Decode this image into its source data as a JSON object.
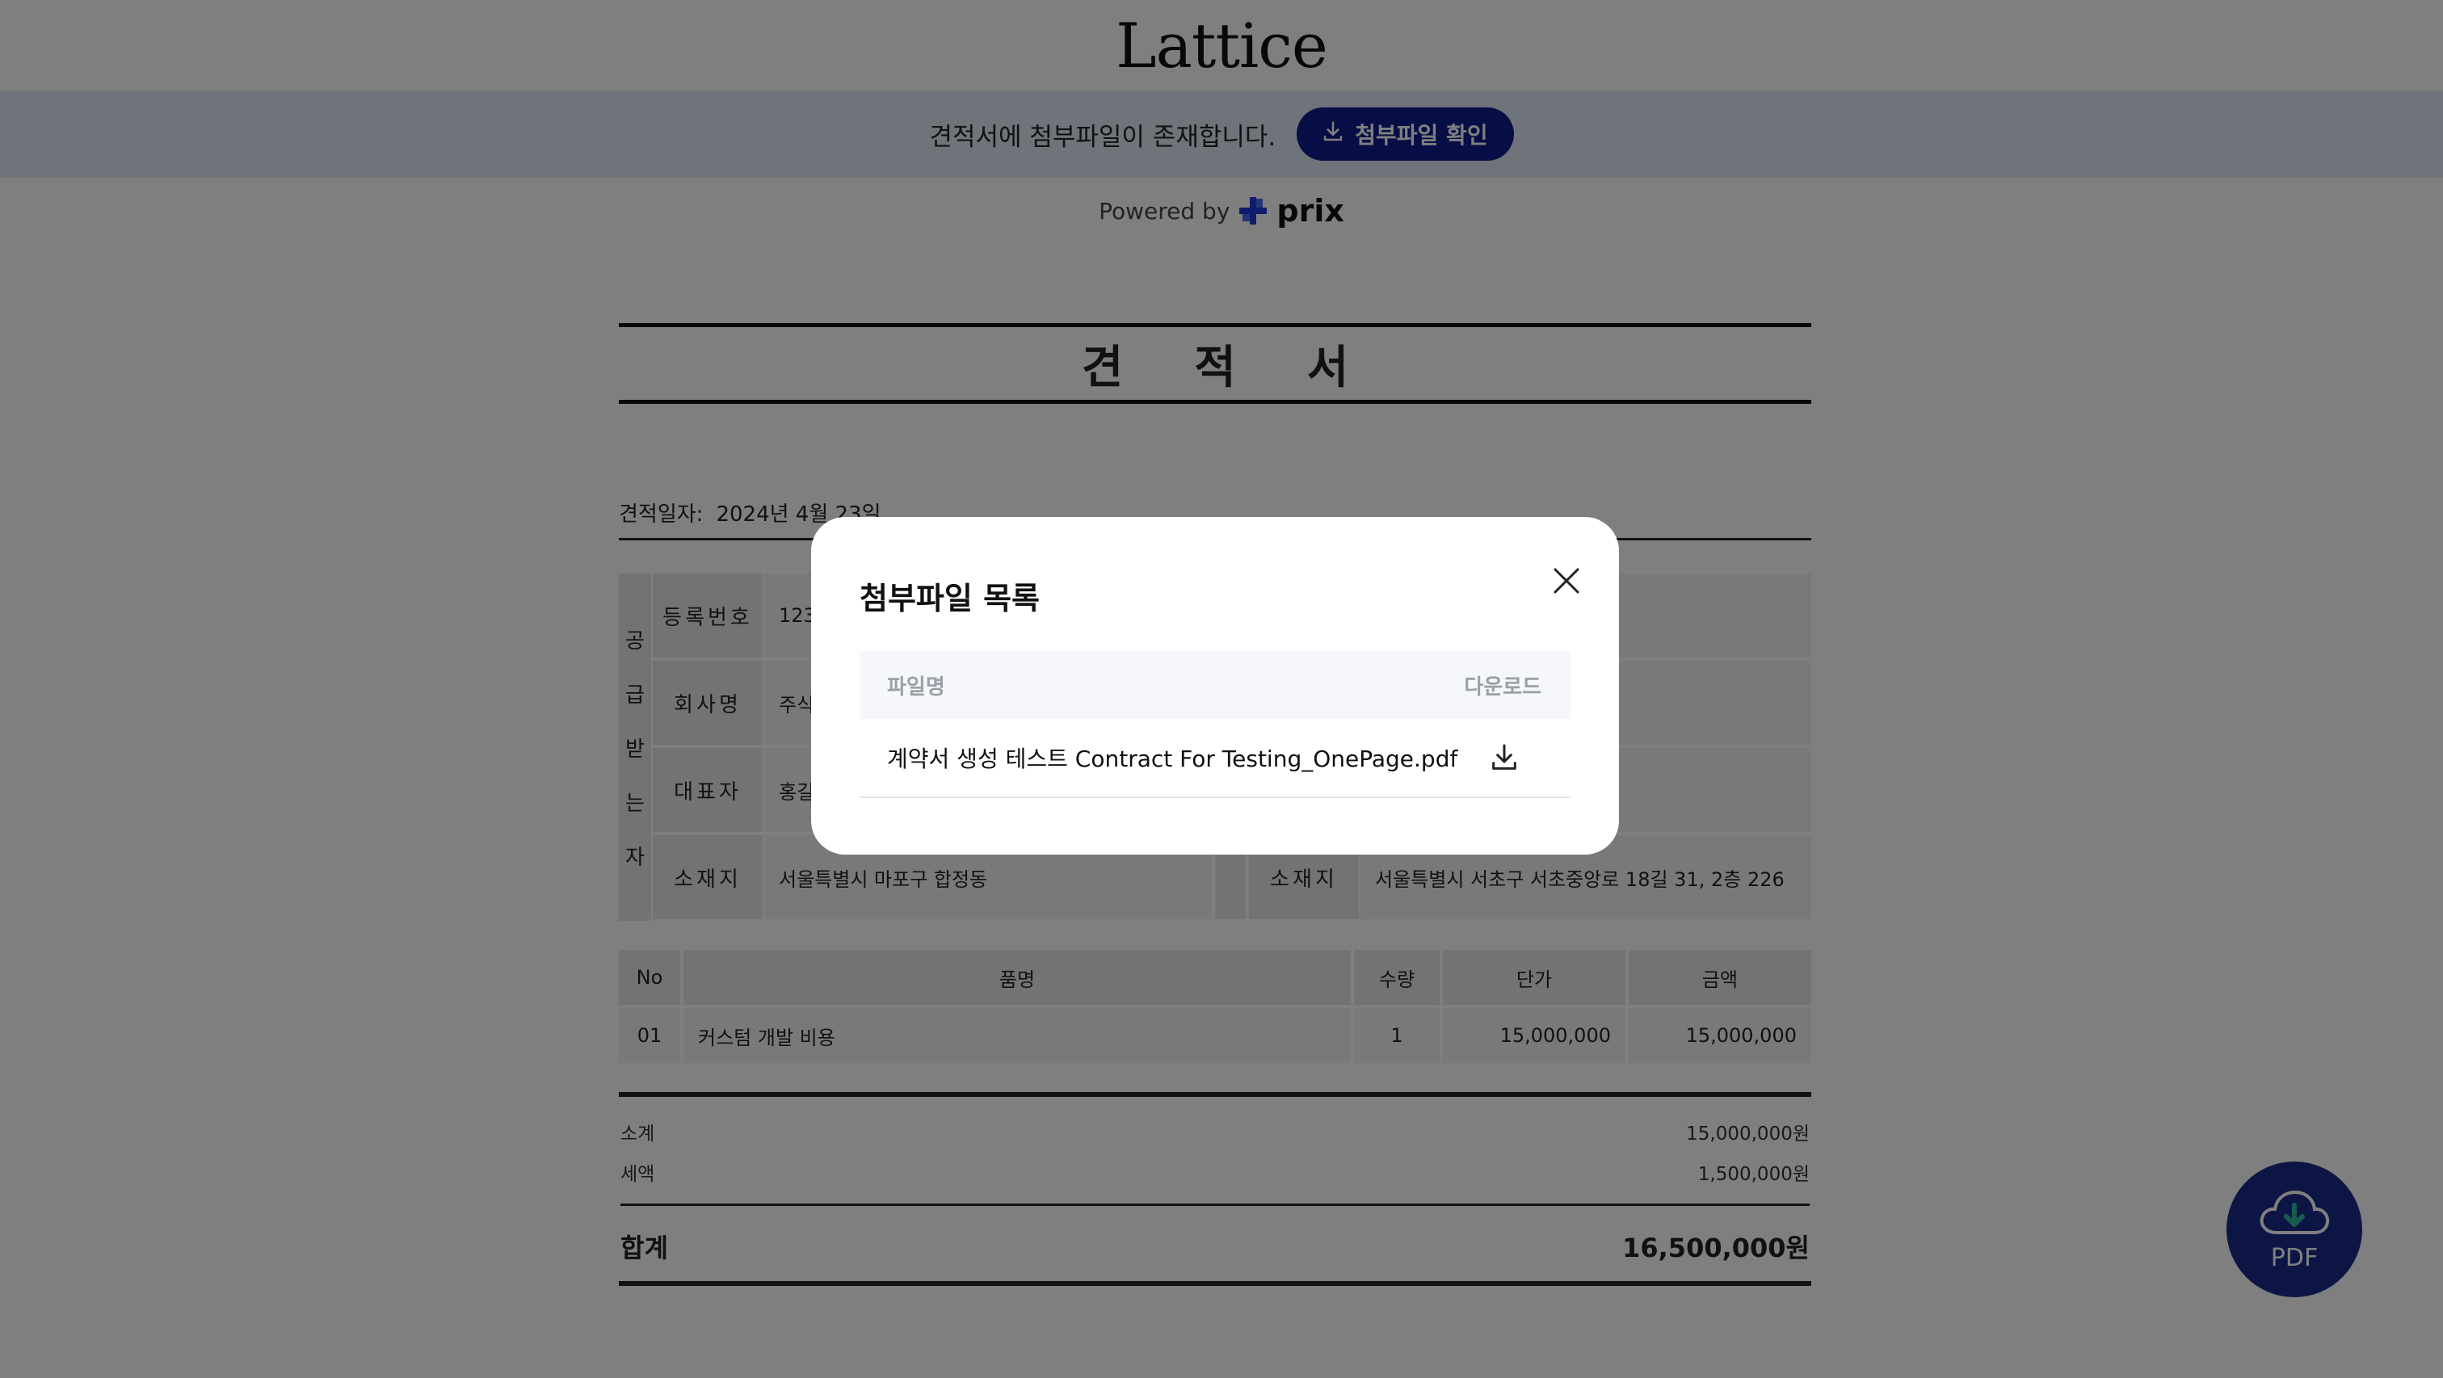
{
  "header": {
    "logo": "Lattice"
  },
  "banner": {
    "text": "견적서에 첨부파일이 존재합니다.",
    "button_label": "첨부파일 확인"
  },
  "powered": {
    "prefix": "Powered by",
    "brand": "prix"
  },
  "quote": {
    "title": "견적서",
    "date_label": "견적일자:",
    "date_value": "2024년 4월 23일",
    "recipient": {
      "side_label": [
        "공",
        "급",
        "받",
        "는",
        "자"
      ],
      "rows": [
        {
          "label": "등록번호",
          "value": "123"
        },
        {
          "label": "회사명",
          "value": "주식"
        },
        {
          "label": "대표자",
          "value": "홍길"
        },
        {
          "label": "소재지",
          "value": "서울특별시 마포구 합정동"
        }
      ]
    },
    "supplier": {
      "address_label": "소재지",
      "address_value": "서울특별시 서초구 서초중앙로 18길 31, 2층 226"
    },
    "items_header": {
      "no": "No",
      "name": "품명",
      "qty": "수량",
      "unit_price": "단가",
      "amount": "금액"
    },
    "items": [
      {
        "no": "01",
        "name": "커스텀 개발 비용",
        "qty": "1",
        "unit_price": "15,000,000",
        "amount": "15,000,000"
      }
    ],
    "subtotal_label": "소계",
    "subtotal_value": "15,000,000원",
    "tax_label": "세액",
    "tax_value": "1,500,000원",
    "total_label": "합계",
    "total_value": "16,500,000원"
  },
  "modal": {
    "title": "첨부파일 목록",
    "col_filename": "파일명",
    "col_download": "다운로드",
    "files": [
      {
        "name": "계약서 생성 테스트 Contract For Testing_OnePage.pdf"
      }
    ]
  },
  "pdf_button": {
    "label": "PDF"
  },
  "colors": {
    "brand_navy": "#0f1d8c",
    "banner_bg": "#dfe6f5",
    "fab": "#1a2b8a",
    "overlay": "rgba(0,0,0,0.5)"
  }
}
